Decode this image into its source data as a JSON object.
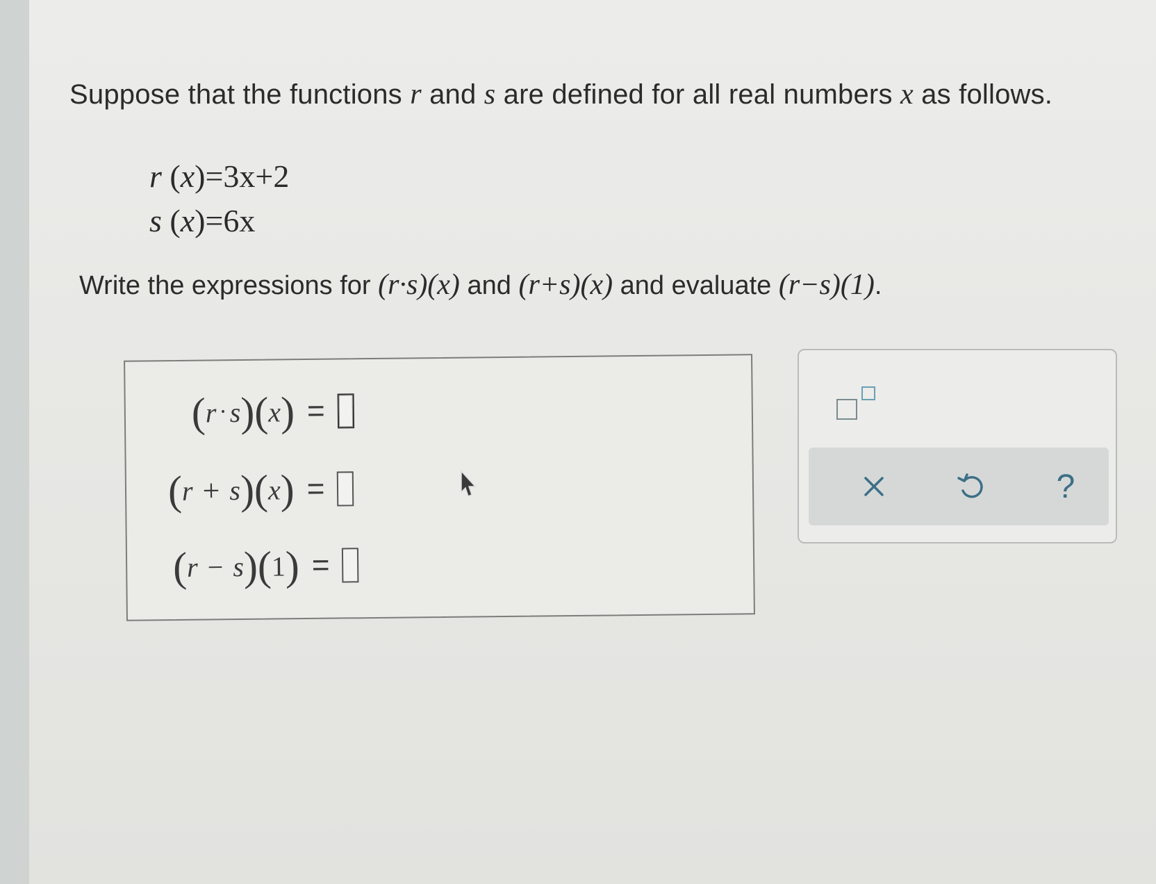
{
  "problem": {
    "intro_start": "Suppose that the functions",
    "var_r": "r",
    "and_word": "and",
    "var_s": "s",
    "intro_mid": "are defined for all real numbers",
    "var_x": "x",
    "intro_end": "as follows."
  },
  "definitions": [
    {
      "name": "r",
      "arg": "x",
      "rhs": "3x+2"
    },
    {
      "name": "s",
      "arg": "x",
      "rhs": "6x"
    }
  ],
  "task": {
    "prefix": "Write the expressions for",
    "expr1": "(r·s)(x)",
    "and1": "and",
    "expr2": "(r+s)(x)",
    "and2": "and evaluate",
    "expr3": "(r−s)(1)",
    "suffix": "."
  },
  "answers": [
    {
      "left_a": "r",
      "op": "·",
      "left_b": "s",
      "arg": "x",
      "equals": "=",
      "value": ""
    },
    {
      "left_a": "r",
      "op": "+",
      "left_b": "s",
      "arg": "x",
      "equals": "=",
      "value": ""
    },
    {
      "left_a": "r",
      "op": "−",
      "left_b": "s",
      "arg": "1",
      "equals": "=",
      "value": ""
    }
  ],
  "toolbar": {
    "superscript_icon": "superscript-template-icon",
    "clear_icon": "close-icon",
    "undo_icon": "undo-icon",
    "help_label": "?"
  },
  "colors": {
    "accent": "#3c6f86",
    "panel_bar": "#d6d8d8"
  }
}
